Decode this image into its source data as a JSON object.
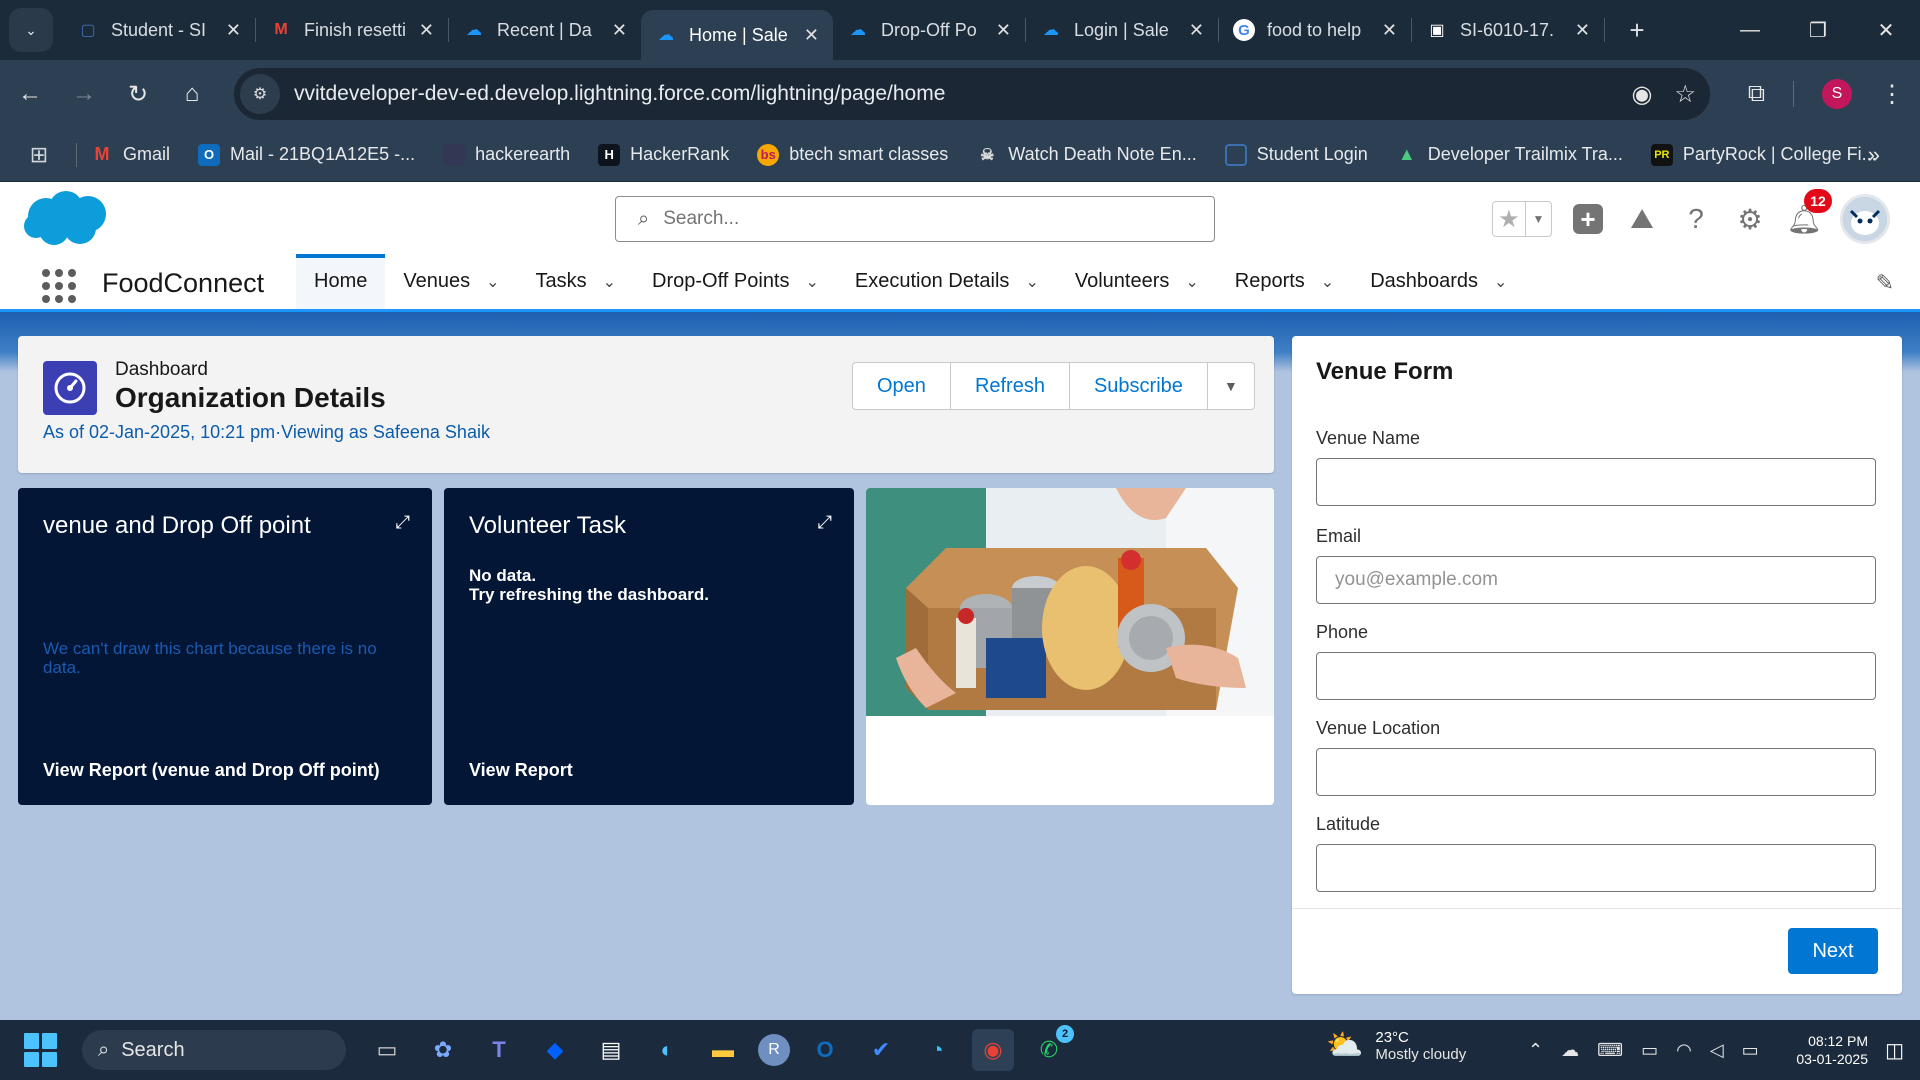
{
  "browser": {
    "tabs": [
      {
        "label": "Student - SI",
        "icon": "S",
        "color": "#3a6fb0"
      },
      {
        "label": "Finish resetti",
        "icon": "M",
        "color": "#ea4335"
      },
      {
        "label": "Recent | Da",
        "icon": "☁",
        "color": "#1b96ff"
      },
      {
        "label": "Home | Sale",
        "icon": "☁",
        "color": "#1b96ff"
      },
      {
        "label": "Drop-Off Po",
        "icon": "☁",
        "color": "#1b96ff"
      },
      {
        "label": "Login | Sale",
        "icon": "☁",
        "color": "#1b96ff"
      },
      {
        "label": "food to help",
        "icon": "G",
        "color": "#ffffff"
      },
      {
        "label": "SI-6010-17.",
        "icon": "▣",
        "color": "#ffffff"
      }
    ],
    "url": "vvitdeveloper-dev-ed.develop.lightning.force.com/lightning/page/home",
    "profile_initial": "S",
    "bookmarks": [
      {
        "label": "Gmail",
        "icon": "M",
        "color": "#ea4335"
      },
      {
        "label": "Mail - 21BQ1A12E5 -...",
        "icon": "O",
        "color": "#0f6cbd"
      },
      {
        "label": "hackerearth",
        "icon": "",
        "color": "#323754"
      },
      {
        "label": "HackerRank",
        "icon": "H",
        "color": "#0e141e"
      },
      {
        "label": "btech smart classes",
        "icon": "bs",
        "color": "#f6a800"
      },
      {
        "label": "Watch Death Note En...",
        "icon": "☠",
        "color": "#444"
      },
      {
        "label": "Student Login",
        "icon": "▢",
        "color": "#3a6fb0"
      },
      {
        "label": "Developer Trailmix Tra...",
        "icon": "▲",
        "color": "#4bca81"
      },
      {
        "label": "PartyRock | College Fi...",
        "icon": "PR",
        "color": "#111"
      }
    ]
  },
  "salesforce": {
    "search_placeholder": "Search...",
    "notification_count": "12",
    "app_name": "FoodConnect",
    "nav": [
      {
        "label": "Home",
        "active": true,
        "chevron": false
      },
      {
        "label": "Venues",
        "active": false,
        "chevron": true
      },
      {
        "label": "Tasks",
        "active": false,
        "chevron": true
      },
      {
        "label": "Drop-Off Points",
        "active": false,
        "chevron": true
      },
      {
        "label": "Execution Details",
        "active": false,
        "chevron": true
      },
      {
        "label": "Volunteers",
        "active": false,
        "chevron": true
      },
      {
        "label": "Reports",
        "active": false,
        "chevron": true
      },
      {
        "label": "Dashboards",
        "active": false,
        "chevron": true
      }
    ]
  },
  "dashboard": {
    "label": "Dashboard",
    "title": "Organization Details",
    "subtitle": "As of 02-Jan-2025, 10:21 pm·Viewing as Safeena Shaik",
    "buttons": {
      "open": "Open",
      "refresh": "Refresh",
      "subscribe": "Subscribe"
    },
    "tiles": [
      {
        "title": "venue and Drop Off point",
        "message": "We can't draw this chart because there is no data.",
        "link": "View Report (venue and Drop Off point)"
      },
      {
        "title": "Volunteer Task",
        "message_line1": "No data.",
        "message_line2": "Try refreshing the dashboard.",
        "link": "View Report"
      }
    ]
  },
  "venue_form": {
    "title": "Venue Form",
    "fields": [
      {
        "label": "Venue Name",
        "value": "",
        "placeholder": ""
      },
      {
        "label": "Email",
        "value": "",
        "placeholder": "you@example.com"
      },
      {
        "label": "Phone",
        "value": "",
        "placeholder": ""
      },
      {
        "label": "Venue Location",
        "value": "",
        "placeholder": ""
      },
      {
        "label": "Latitude",
        "value": "",
        "placeholder": ""
      }
    ],
    "next_label": "Next"
  },
  "taskbar": {
    "search_label": "Search",
    "weather_temp": "23°C",
    "weather_desc": "Mostly cloudy",
    "time": "08:12 PM",
    "date": "03-01-2025",
    "whatsapp_badge": "2"
  }
}
